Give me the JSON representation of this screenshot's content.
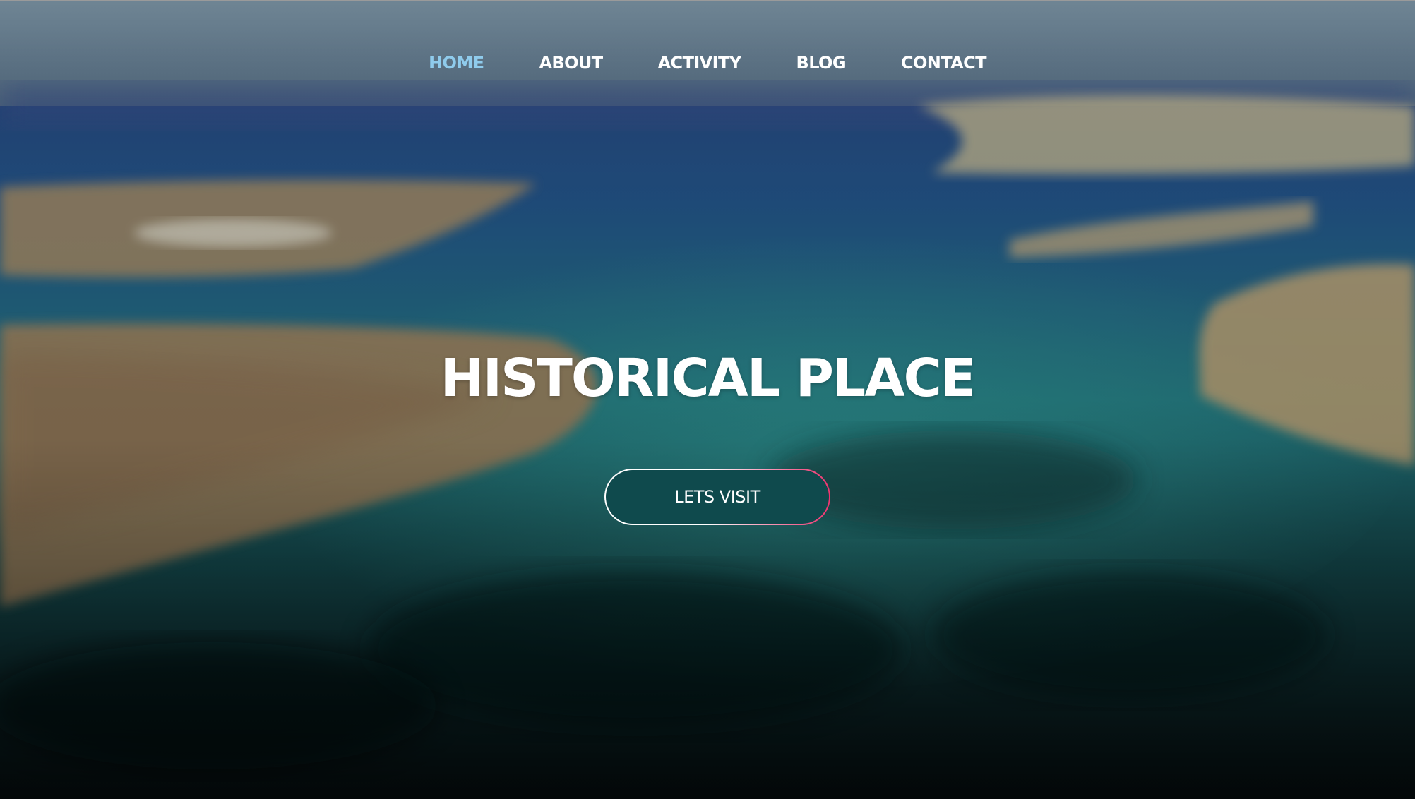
{
  "nav": {
    "items": [
      {
        "label": "HOME",
        "active": true
      },
      {
        "label": "ABOUT",
        "active": false
      },
      {
        "label": "ACTIVITY",
        "active": false
      },
      {
        "label": "BLOG",
        "active": false
      },
      {
        "label": "CONTACT",
        "active": false
      }
    ]
  },
  "hero": {
    "title": "HISTORICAL PLACE",
    "cta_label": "LETS VISIT",
    "background": "aerial-coastline-photo"
  },
  "colors": {
    "nav_active": "#8fcbec",
    "nav_text": "#ffffff",
    "cta_gradient_end": "#f0336f",
    "title_text": "#ffffff"
  }
}
